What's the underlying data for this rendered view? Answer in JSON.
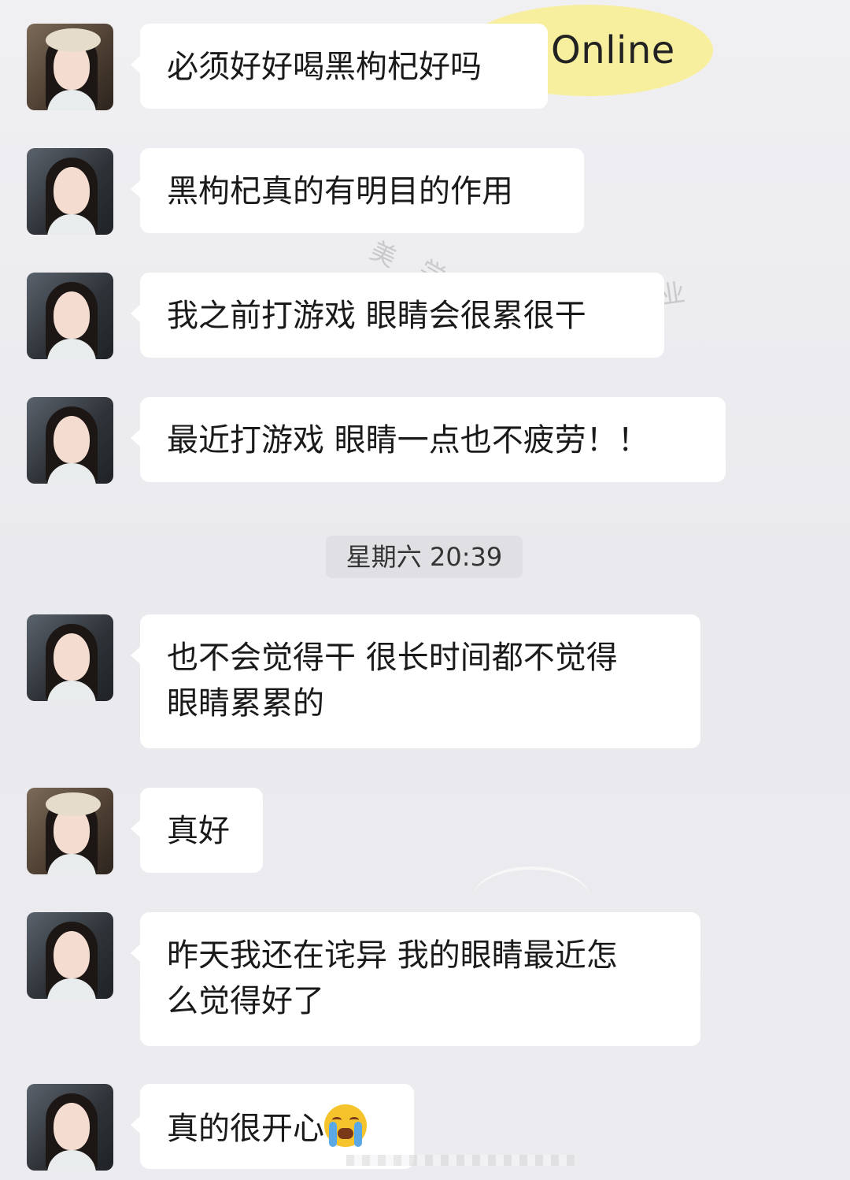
{
  "header": {
    "status_label": "Online"
  },
  "timestamp": "星期六 20:39",
  "messages": [
    {
      "text": "必须好好喝黑枸杞好吗",
      "avatar": "beret"
    },
    {
      "text": "黑枸杞真的有明目的作用",
      "avatar": "plain"
    },
    {
      "text": "我之前打游戏 眼睛会很累很干",
      "avatar": "plain"
    },
    {
      "text": "最近打游戏 眼睛一点也不疲劳！！",
      "avatar": "plain"
    },
    {
      "text_line1": "也不会觉得干 很长时间都不觉得",
      "text_line2": "眼睛累累的",
      "avatar": "plain"
    },
    {
      "text": "真好",
      "avatar": "beret"
    },
    {
      "text_line1": "昨天我还在诧异 我的眼睛最近怎",
      "text_line2": "么觉得好了",
      "avatar": "plain"
    },
    {
      "text": "真的很开心",
      "emoji": "loudly-crying-face-icon",
      "avatar": "plain"
    }
  ],
  "watermark": {
    "chars": [
      "美",
      "学",
      "业"
    ]
  },
  "colors": {
    "bubble": "#ffffff",
    "background": "#ececf0",
    "online_highlight": "#f7ef9e"
  }
}
